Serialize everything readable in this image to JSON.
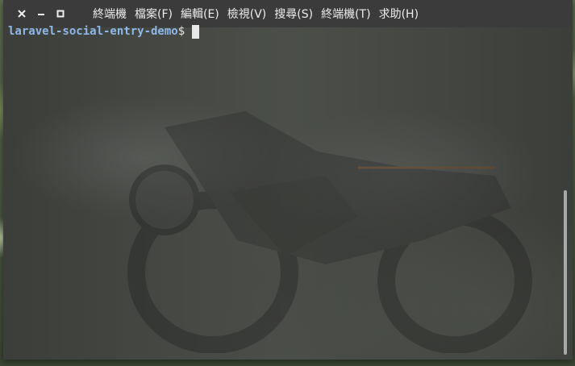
{
  "window": {
    "controls": {
      "close": "close-icon",
      "minimize": "minimize-icon",
      "maximize": "maximize-icon"
    }
  },
  "menubar": {
    "items": [
      {
        "label": "終端機"
      },
      {
        "label": "檔案(F)"
      },
      {
        "label": "編輯(E)"
      },
      {
        "label": "檢視(V)"
      },
      {
        "label": "搜尋(S)"
      },
      {
        "label": "終端機(T)"
      },
      {
        "label": "求助(H)"
      }
    ]
  },
  "terminal": {
    "prompt_dir": "laravel-social-entry-demo",
    "prompt_symbol": "$",
    "scroll_position": 0.55
  },
  "colors": {
    "titlebar": "#3b3b3b",
    "terminal_bg": "#3d3d3d",
    "prompt_dir": "#8fb8e8",
    "cursor": "#e8e8e8"
  }
}
